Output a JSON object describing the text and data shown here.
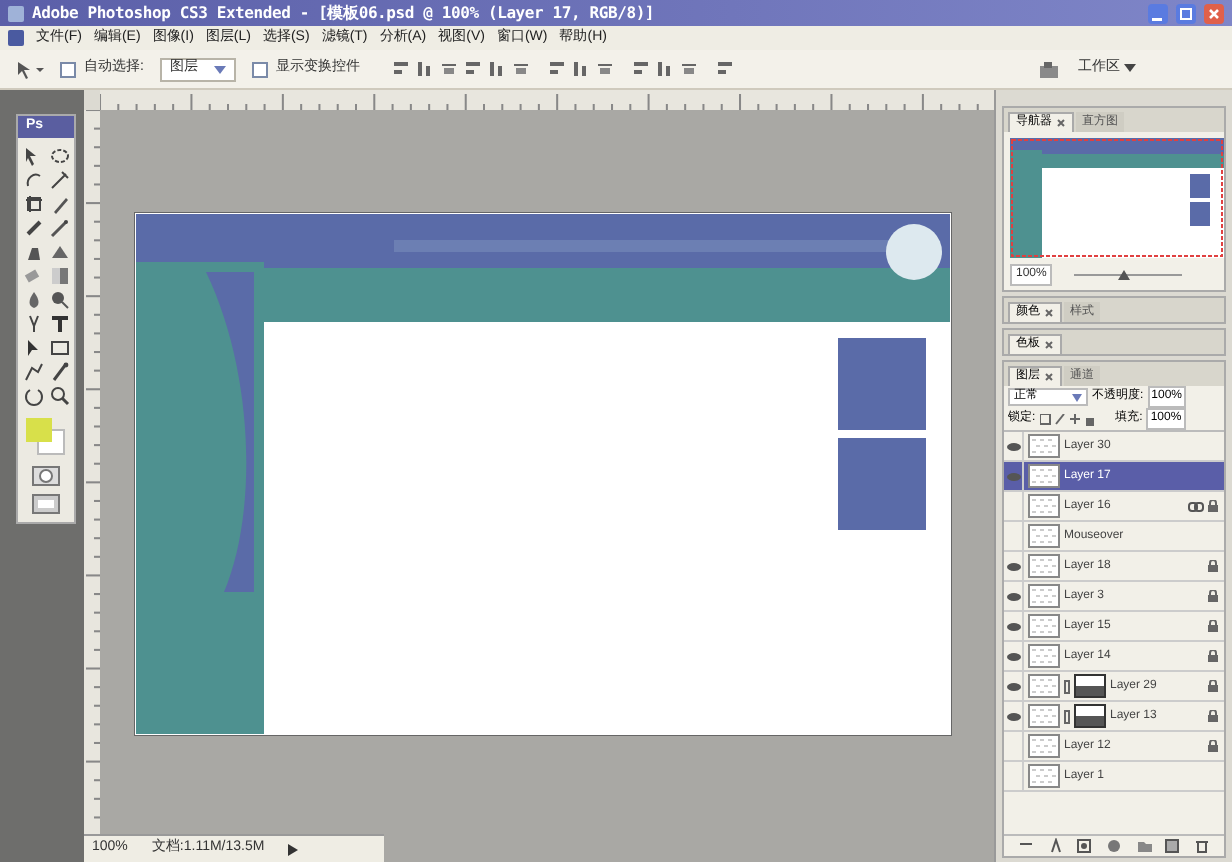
{
  "window": {
    "title": "Adobe Photoshop CS3 Extended - [模板06.psd @ 100% (Layer 17, RGB/8)]"
  },
  "menu": [
    "文件(F)",
    "编辑(E)",
    "图像(I)",
    "图层(L)",
    "选择(S)",
    "滤镜(T)",
    "分析(A)",
    "视图(V)",
    "窗口(W)",
    "帮助(H)"
  ],
  "options_bar": {
    "auto_select_label": "自动选择:",
    "auto_select_value": "图层",
    "auto_select_checked": false,
    "show_transform_label": "显示变换控件",
    "show_transform_checked": false,
    "workspace": "工作区"
  },
  "toolbox": {
    "logo": "Ps"
  },
  "status_bar": {
    "zoom": "100%",
    "document": "文档:1.11M/13.5M"
  },
  "navigator": {
    "tabs": [
      {
        "label": "导航器",
        "selected": true
      },
      {
        "label": "直方图",
        "selected": false
      }
    ],
    "zoom": "100%",
    "zoom_slider": {
      "level": 0.45
    }
  },
  "color_panel": {
    "tabs": [
      {
        "label": "颜色",
        "selected": true
      },
      {
        "label": "样式",
        "selected": false
      }
    ]
  },
  "swatches_panel": {
    "tabs": [
      {
        "label": "色板",
        "selected": true
      }
    ]
  },
  "layers_panel": {
    "tabs": [
      {
        "label": "图层",
        "selected": true
      },
      {
        "label": "通道",
        "selected": false
      }
    ],
    "blend_mode": "正常",
    "opacity_label": "不透明度:",
    "opacity": "100%",
    "lock_label": "锁定:",
    "fill_label": "填充:",
    "fill": "100%",
    "layers": [
      {
        "name": "Layer 30",
        "visible": true,
        "selected": false,
        "kind": "plain",
        "locked": false,
        "linked": false
      },
      {
        "name": "Layer 17",
        "visible": true,
        "selected": true,
        "kind": "plain",
        "locked": false,
        "linked": false
      },
      {
        "name": "Layer 16",
        "visible": false,
        "selected": false,
        "kind": "plain",
        "locked": true,
        "linked": true
      },
      {
        "name": "Mouseover",
        "visible": false,
        "selected": false,
        "kind": "plain",
        "locked": false,
        "linked": false
      },
      {
        "name": "Layer 18",
        "visible": true,
        "selected": false,
        "kind": "plain",
        "locked": true,
        "linked": false
      },
      {
        "name": "Layer 3",
        "visible": true,
        "selected": false,
        "kind": "plain",
        "locked": true,
        "linked": false
      },
      {
        "name": "Layer 15",
        "visible": true,
        "selected": false,
        "kind": "plain",
        "locked": true,
        "linked": false
      },
      {
        "name": "Layer 14",
        "visible": true,
        "selected": false,
        "kind": "plain",
        "locked": true,
        "linked": false
      },
      {
        "name": "Layer 29",
        "visible": true,
        "selected": false,
        "kind": "masked",
        "locked": true,
        "linked": false
      },
      {
        "name": "Layer 13",
        "visible": true,
        "selected": false,
        "kind": "masked",
        "locked": true,
        "linked": false
      },
      {
        "name": "Layer 12",
        "visible": false,
        "selected": false,
        "kind": "plain",
        "locked": true,
        "linked": false
      },
      {
        "name": "Layer 1",
        "visible": false,
        "selected": false,
        "kind": "plain",
        "locked": false,
        "linked": false
      }
    ]
  }
}
